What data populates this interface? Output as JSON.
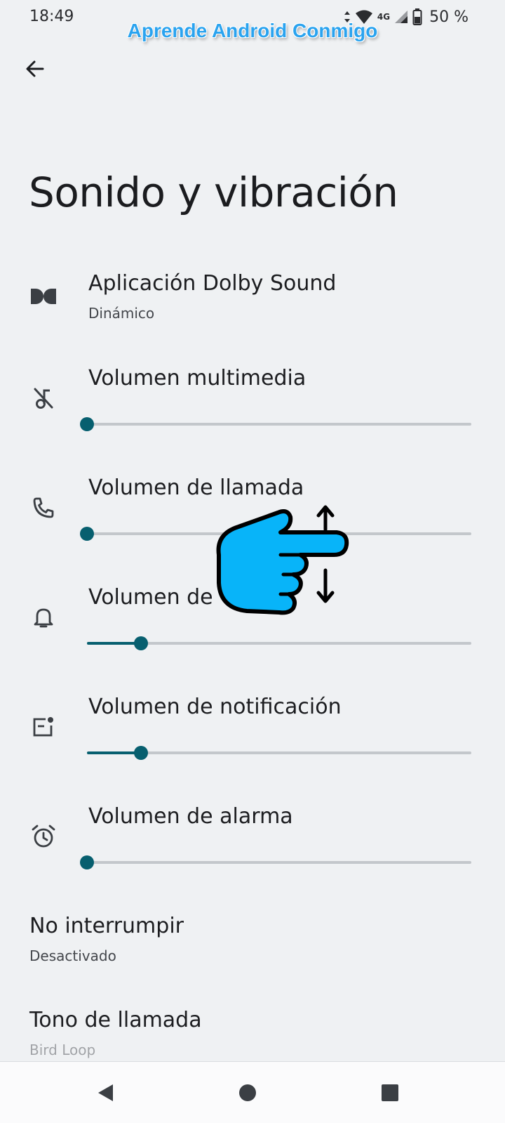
{
  "status_bar": {
    "time": "18:49",
    "network": "4G",
    "battery": "50 %"
  },
  "watermark": "Aprende Android Conmigo",
  "header": {
    "back_icon": "arrow-back-icon",
    "title": "Sonido y vibración"
  },
  "settings": {
    "dolby": {
      "icon": "dolby-icon",
      "title": "Aplicación Dolby Sound",
      "subtitle": "Dinámico"
    },
    "media": {
      "icon": "music-off-icon",
      "title": "Volumen multimedia",
      "level": 0.0
    },
    "call": {
      "icon": "phone-icon",
      "title": "Volumen de llamada",
      "level": 0.0
    },
    "ring": {
      "icon": "bell-icon",
      "title": "Volumen de",
      "level": 0.14
    },
    "notification": {
      "icon": "notification-icon",
      "title": "Volumen de notificación",
      "level": 0.14
    },
    "alarm": {
      "icon": "alarm-icon",
      "title": "Volumen de alarma",
      "level": 0.0
    },
    "dnd": {
      "title": "No interrumpir",
      "subtitle": "Desactivado"
    },
    "ringtone": {
      "title": "Tono de llamada",
      "subtitle": "Bird Loop"
    }
  },
  "overlay": {
    "icon": "pointing-hand-icon"
  },
  "navbar": {
    "back_icon": "nav-back-icon",
    "home_icon": "nav-home-icon",
    "recents_icon": "nav-recents-icon"
  },
  "colors": {
    "accent": "#075f6f",
    "track": "#c3c7cb",
    "background": "#eff1f3",
    "watermark": "#2aa3ef",
    "hand": "#08b4f9"
  }
}
